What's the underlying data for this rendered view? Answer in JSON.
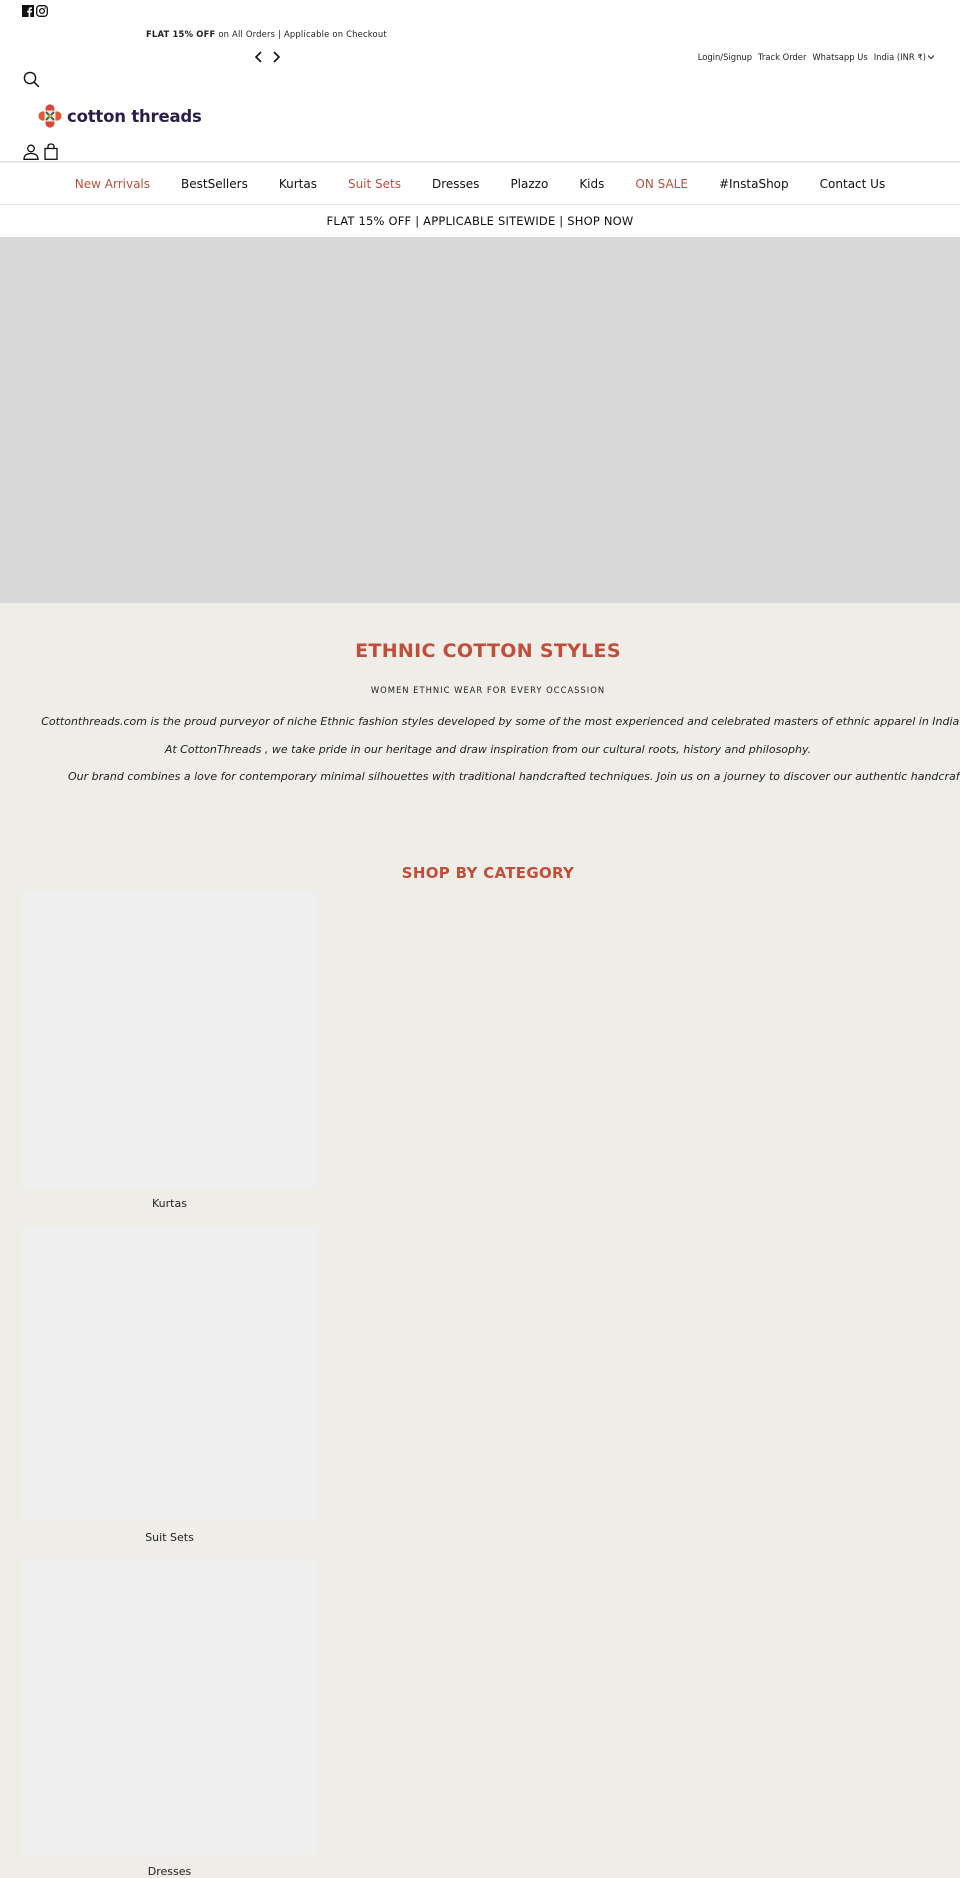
{
  "header": {
    "social": [
      {
        "icon": "facebook-icon",
        "label": "Facebook"
      },
      {
        "icon": "instagram-icon",
        "label": "Instagram"
      }
    ],
    "announcement": {
      "bold": "FLAT 15% OFF",
      "text": " on All Orders | Applicable on Checkout"
    },
    "top_links": {
      "login": "Login/Signup",
      "track": "Track Order",
      "whatsapp": "Whatsapp Us",
      "currency": "India (INR ₹)"
    },
    "logo_text": "cotton threads",
    "colors": {
      "logo_text": "#2b1f4a",
      "accent": "#c04e3a"
    }
  },
  "nav": {
    "items": [
      {
        "label": "New Arrivals",
        "accent": true
      },
      {
        "label": "BestSellers",
        "accent": false
      },
      {
        "label": "Kurtas",
        "accent": false
      },
      {
        "label": "Suit Sets",
        "accent": true
      },
      {
        "label": "Dresses",
        "accent": false
      },
      {
        "label": "Plazzo",
        "accent": false
      },
      {
        "label": "Kids",
        "accent": false
      },
      {
        "label": "ON SALE",
        "accent": true
      },
      {
        "label": "#InstaShop",
        "accent": false
      },
      {
        "label": "Contact Us",
        "accent": false
      }
    ]
  },
  "promo_bar": "FLAT 15% OFF | APPLICABLE SITEWIDE | SHOP NOW",
  "intro": {
    "title": "ETHNIC COTTON STYLES",
    "subtitle": "WOMEN ETHNIC WEAR FOR EVERY OCCASSION",
    "paragraphs": [
      "Cottonthreads.com is the proud purveyor of niche Ethnic fashion styles developed by some of the most experienced and celebrated masters of ethnic apparel in India.",
      "At CottonThreads , we take pride in our heritage and draw inspiration from our cultural roots, history and philosophy.",
      "Our brand combines a love for contemporary minimal silhouettes with traditional handcrafted techniques. Join us on a journey to discover our authentic handcrafted products"
    ]
  },
  "categories": {
    "title": "SHOP BY CATEGORY",
    "items": [
      {
        "label": "Kurtas"
      },
      {
        "label": "Suit Sets"
      },
      {
        "label": "Dresses"
      }
    ]
  }
}
